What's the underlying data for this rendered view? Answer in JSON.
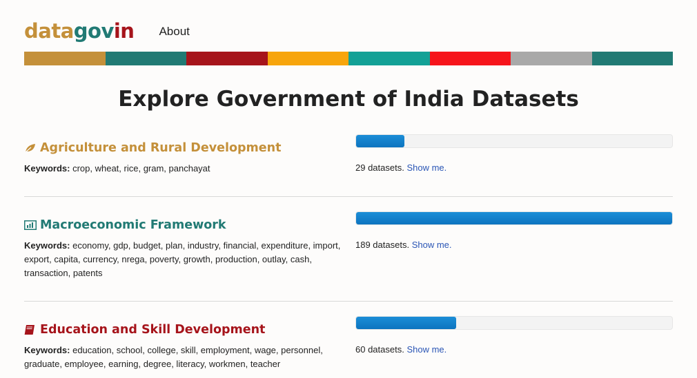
{
  "header": {
    "logo_part1": "data",
    "logo_part2": "gov",
    "logo_part3": "in",
    "about_label": "About"
  },
  "stripe_colors": [
    "#c4903a",
    "#217a74",
    "#a6141b",
    "#f7a50c",
    "#13a196",
    "#f6141b",
    "#a9a9a9",
    "#217a74"
  ],
  "page_title": "Explore Government of India Datasets",
  "keywords_label": "Keywords:",
  "show_me_label": "Show me.",
  "sections": [
    {
      "title": "Agriculture and Rural Development",
      "color": "#c4903a",
      "icon": "leaf-icon",
      "keywords": "crop, wheat, rice, gram, panchayat",
      "count_text": "29 datasets.",
      "fraction": 0.153
    },
    {
      "title": "Macroeconomic Framework",
      "color": "#217a74",
      "icon": "bar-chart-icon",
      "keywords": "economy, gdp, budget, plan, industry, financial, expenditure, import, export, capita, currency, nrega, poverty, growth, production, outlay, cash, transaction, patents",
      "count_text": "189 datasets.",
      "fraction": 1.0
    },
    {
      "title": "Education and Skill Development",
      "color": "#a6141b",
      "icon": "book-icon",
      "keywords": "education, school, college, skill, employment, wage, personnel, graduate, employee, earning, degree, literacy, workmen, teacher",
      "count_text": "60 datasets.",
      "fraction": 0.317
    }
  ]
}
